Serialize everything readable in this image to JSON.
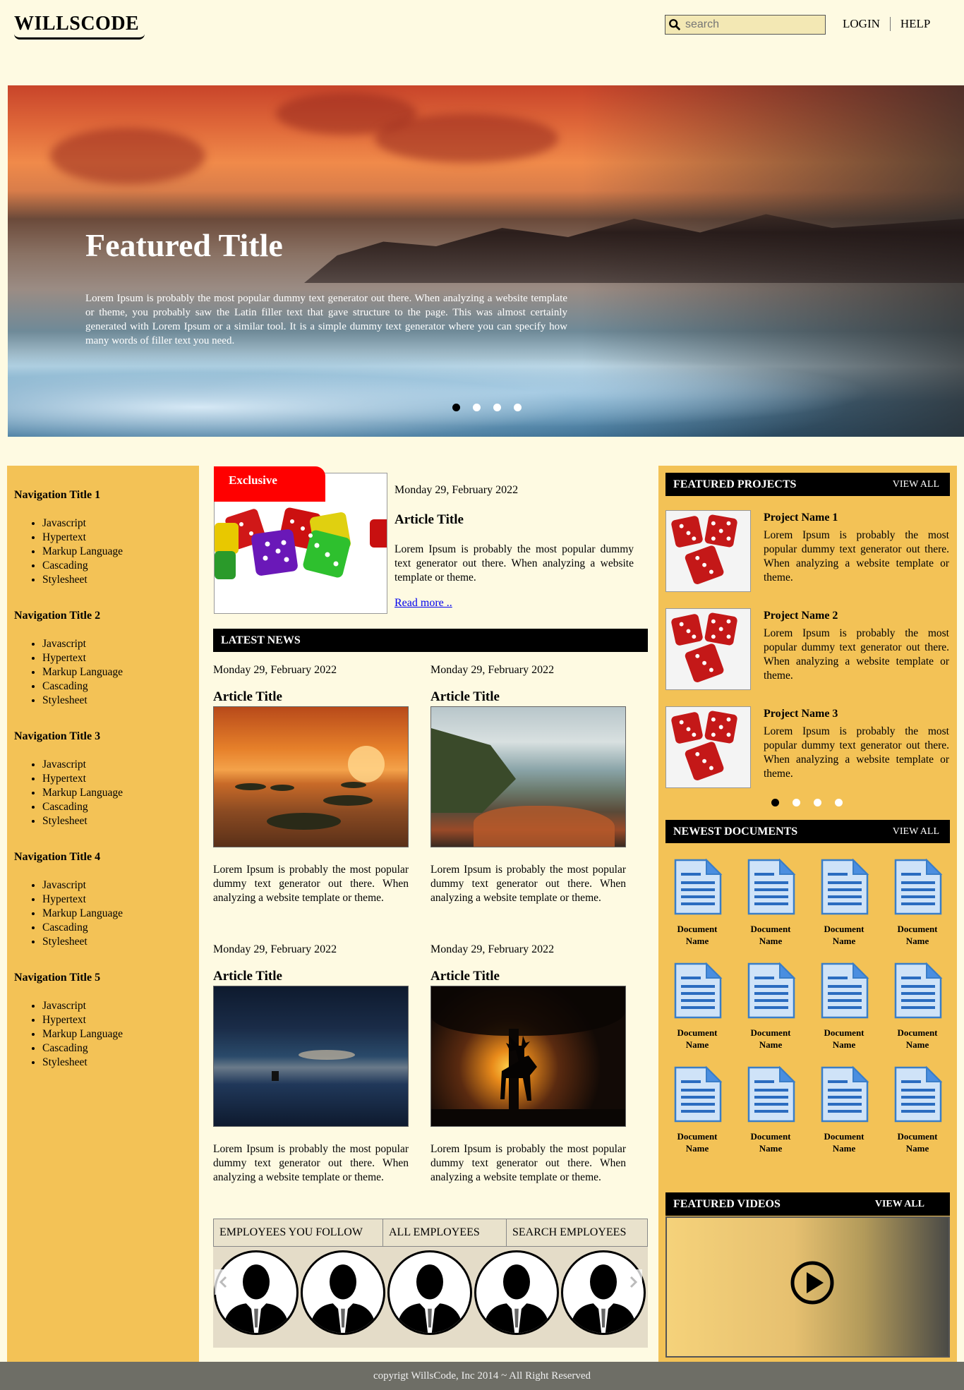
{
  "header": {
    "logo": "WILLSCODE",
    "search_placeholder": "search",
    "nav": [
      "LOGIN",
      "HELP"
    ]
  },
  "hero": {
    "title": "Featured Title",
    "text": "Lorem Ipsum is probably the most popular dummy text generator out there. When analyzing a website template or theme, you probably saw the Latin filler text that gave structure to the page. This was almost certainly generated with Lorem Ipsum or a similar tool. It is a simple dummy text generator where you can specify how many words of filler text you need.",
    "slides": 4,
    "active_slide": 1
  },
  "sidebar": {
    "groups": [
      {
        "title": "Navigation Title 1",
        "items": [
          "Javascript",
          "Hypertext",
          "Markup Language",
          "Cascading",
          "Stylesheet"
        ]
      },
      {
        "title": "Navigation Title 2",
        "items": [
          "Javascript",
          "Hypertext",
          "Markup Language",
          "Cascading",
          "Stylesheet"
        ]
      },
      {
        "title": "Navigation Title 3",
        "items": [
          "Javascript",
          "Hypertext",
          "Markup Language",
          "Cascading",
          "Stylesheet"
        ]
      },
      {
        "title": "Navigation Title 4",
        "items": [
          "Javascript",
          "Hypertext",
          "Markup Language",
          "Cascading",
          "Stylesheet"
        ]
      },
      {
        "title": "Navigation Title 5",
        "items": [
          "Javascript",
          "Hypertext",
          "Markup Language",
          "Cascading",
          "Stylesheet"
        ]
      }
    ]
  },
  "exclusive": {
    "tag": "Exclusive",
    "date": "Monday 29, February 2022",
    "title": "Article Title",
    "text": "Lorem Ipsum is probably the most popular dummy text generator out there. When analyzing a website template or theme.",
    "read_more": "Read more .."
  },
  "latest_news": {
    "heading": "LATEST NEWS",
    "articles": [
      {
        "date": "Monday 29, February 2022",
        "title": "Article Title",
        "image": "sunset-stones",
        "text": "Lorem Ipsum is probably the most popular dummy text generator out there. When analyzing a website template or theme."
      },
      {
        "date": "Monday 29, February 2022",
        "title": "Article Title",
        "image": "rocky-coast",
        "text": "Lorem Ipsum is probably the most popular dummy text generator out there. When analyzing a website template or theme."
      },
      {
        "date": "Monday 29, February 2022",
        "title": "Article Title",
        "image": "night-sea",
        "text": "Lorem Ipsum is probably the most popular dummy text generator out there. When analyzing a website template or theme."
      },
      {
        "date": "Monday 29, February 2022",
        "title": "Article Title",
        "image": "deer-silhouette",
        "text": "Lorem Ipsum is probably the most popular dummy text generator out there. When analyzing a website template or theme."
      }
    ]
  },
  "employees": {
    "tabs": [
      "EMPLOYEES YOU FOLLOW",
      "ALL EMPLOYEES",
      "SEARCH EMPLOYEES"
    ],
    "count": 5
  },
  "featured_projects": {
    "heading": "FEATURED PROJECTS",
    "view_all": "VIEW ALL",
    "projects": [
      {
        "name": "Project Name 1",
        "text": "Lorem Ipsum is probably the most popular dummy text generator out there. When analyzing a website template or theme."
      },
      {
        "name": "Project Name 2",
        "text": "Lorem Ipsum is probably the most popular dummy text generator out there. When analyzing a website template or theme."
      },
      {
        "name": "Project Name 3",
        "text": "Lorem Ipsum is probably the most popular dummy text generator out there. When analyzing a website template or theme."
      }
    ],
    "pages": 4,
    "active_page": 1
  },
  "newest_documents": {
    "heading": "NEWEST DOCUMENTS",
    "view_all": "VIEW ALL",
    "doc_label": [
      "Document",
      "Name"
    ],
    "count": 12
  },
  "featured_videos": {
    "heading": "FEATURED VIDEOS",
    "view_all": "VIEW ALL"
  },
  "footer": "copyrigt WillsCode, Inc 2014 ~ All Right Reserved",
  "colors": {
    "background": "#fefae2",
    "sidebar": "#f3c256",
    "exclusive_tag": "#ff0000",
    "bar": "#000000",
    "footer": "#6e6e66"
  }
}
